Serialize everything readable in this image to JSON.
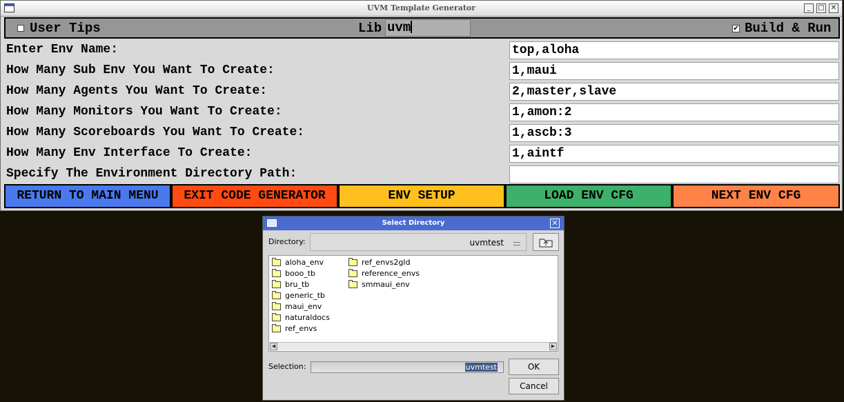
{
  "window": {
    "title": "UVM Template Generator"
  },
  "toolbar": {
    "user_tips_label": "User Tips",
    "user_tips_checked": false,
    "lib_label": "Lib",
    "lib_value": "uvm",
    "build_run_label": "Build & Run",
    "build_run_checked": true
  },
  "form": {
    "rows": [
      {
        "label": "Enter Env Name:",
        "value": "top,aloha"
      },
      {
        "label": "How Many Sub Env You Want To Create:",
        "value": "1,maui"
      },
      {
        "label": "How Many Agents You Want To Create:",
        "value": "2,master,slave"
      },
      {
        "label": "How Many Monitors You Want To Create:",
        "value": "1,amon:2"
      },
      {
        "label": "How Many Scoreboards You Want To Create:",
        "value": "1,ascb:3"
      },
      {
        "label": "How Many Env Interface To Create:",
        "value": "1,aintf"
      },
      {
        "label": "Specify The Environment Directory Path:",
        "value": ""
      }
    ]
  },
  "buttons": [
    {
      "label": "RETURN TO MAIN MENU",
      "color": "#4a79ee"
    },
    {
      "label": "EXIT CODE GENERATOR",
      "color": "#ff4a12"
    },
    {
      "label": "ENV SETUP",
      "color": "#ffbf1c"
    },
    {
      "label": "LOAD ENV CFG",
      "color": "#3db16a"
    },
    {
      "label": "NEXT ENV CFG",
      "color": "#ff8246"
    }
  ],
  "dialog": {
    "title": "Select Directory",
    "directory_label": "Directory:",
    "directory_value": "uvmtest",
    "files": [
      "aloha_env",
      "booo_tb",
      "bru_tb",
      "generic_tb",
      "maui_env",
      "naturaldocs",
      "ref_envs",
      "ref_envs2gld",
      "reference_envs",
      "smmaui_env"
    ],
    "selection_label": "Selection:",
    "selection_value": "uvmtest",
    "ok_label": "OK",
    "cancel_label": "Cancel",
    "folder_color": "#ffff99",
    "titlebar_color": "#4a6bcf"
  }
}
